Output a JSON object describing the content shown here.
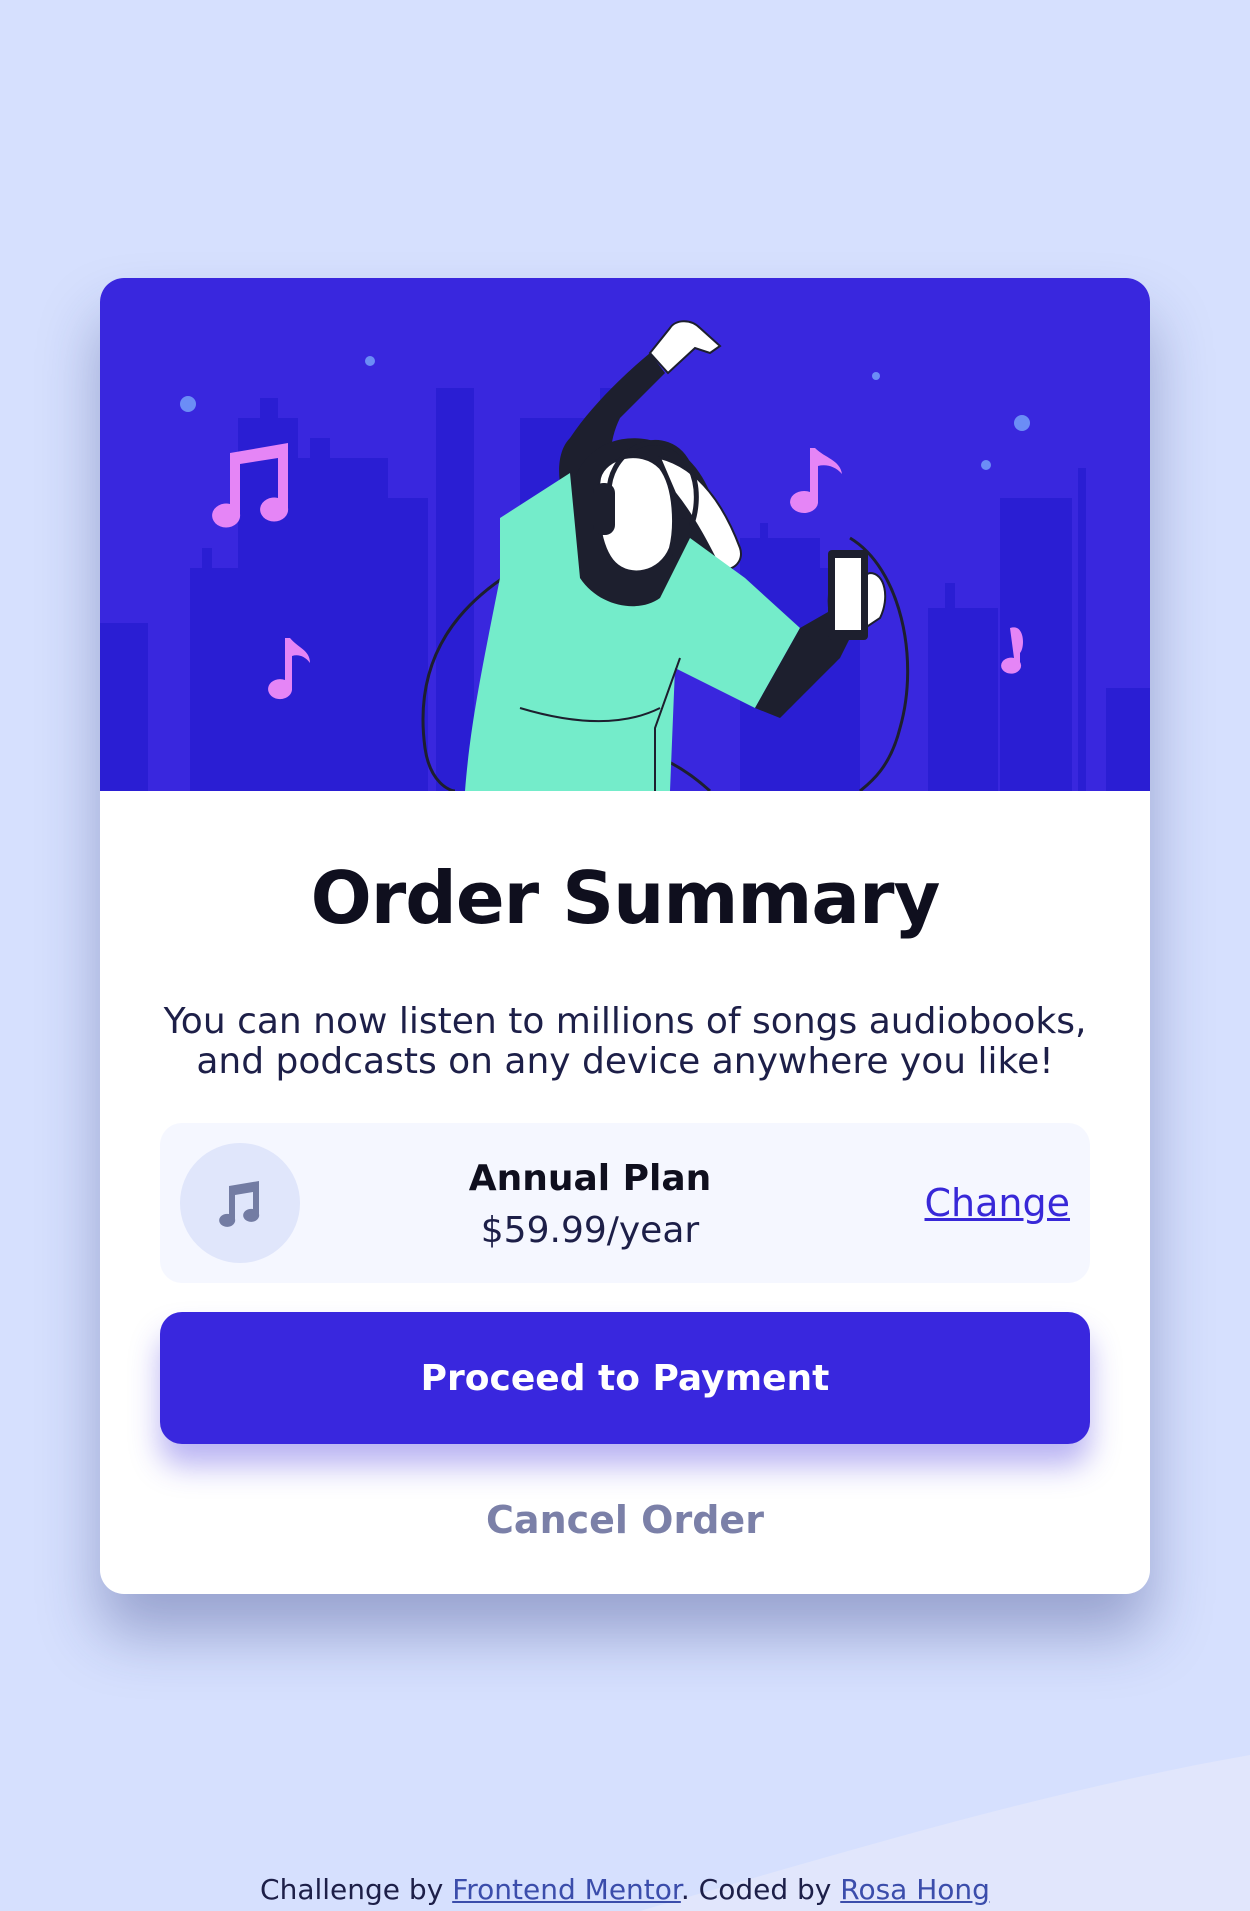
{
  "card": {
    "title": "Order Summary",
    "description": "You can now listen to millions of songs audiobooks, and podcasts on any device anywhere you like!"
  },
  "plan": {
    "icon": "music-note-icon",
    "name": "Annual Plan",
    "price": "$59.99/year",
    "change_label": "Change"
  },
  "actions": {
    "proceed_label": "Proceed to Payment",
    "cancel_label": "Cancel Order"
  },
  "footer": {
    "prefix": "Challenge by ",
    "mentor_link": "Frontend Mentor",
    "middle": ". Coded by ",
    "author_link": "Rosa Hong"
  },
  "colors": {
    "background": "#d6e0fe",
    "hero": "#3927de",
    "primary_button": "#3927de",
    "link": "#3828d8",
    "cancel_text": "#7b80a8"
  }
}
